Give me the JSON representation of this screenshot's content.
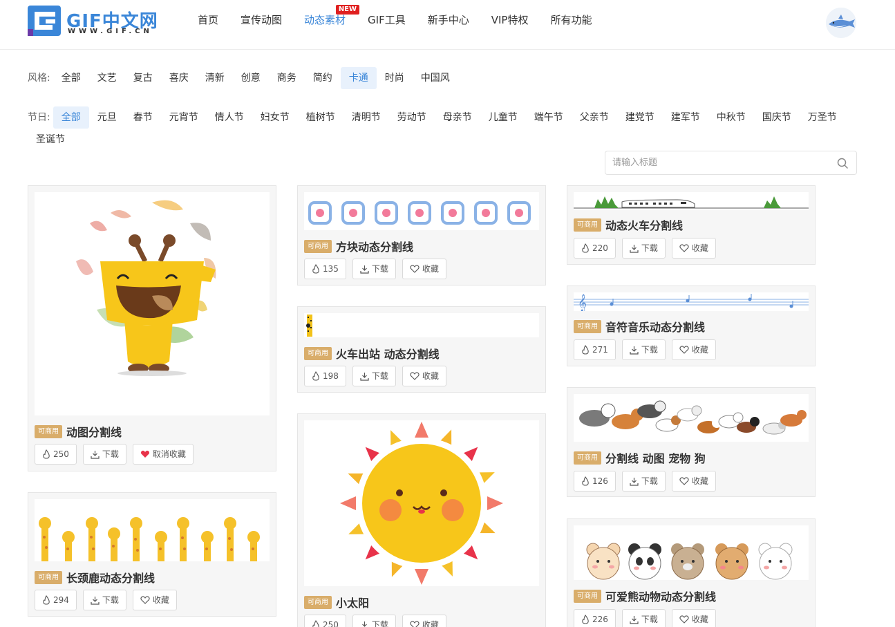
{
  "header": {
    "logo_text": "GIF中文网",
    "logo_sub": "WWW.GIF.CN",
    "nav": [
      {
        "label": "首页",
        "active": false
      },
      {
        "label": "宣传动图",
        "active": false
      },
      {
        "label": "动态素材",
        "active": true,
        "badge": "NEW"
      },
      {
        "label": "GIF工具",
        "active": false
      },
      {
        "label": "新手中心",
        "active": false
      },
      {
        "label": "VIP特权",
        "active": false
      },
      {
        "label": "所有功能",
        "active": false
      }
    ]
  },
  "filters": {
    "style": {
      "label": "风格:",
      "items": [
        "全部",
        "文艺",
        "复古",
        "喜庆",
        "清新",
        "创意",
        "商务",
        "简约",
        "卡通",
        "时尚",
        "中国风"
      ],
      "selected": "卡通"
    },
    "festival": {
      "label": "节日:",
      "items": [
        "全部",
        "元旦",
        "春节",
        "元宵节",
        "情人节",
        "妇女节",
        "植树节",
        "清明节",
        "劳动节",
        "母亲节",
        "儿童节",
        "端午节",
        "父亲节",
        "建党节",
        "建军节",
        "中秋节",
        "国庆节",
        "万圣节",
        "圣诞节"
      ],
      "selected": "全部"
    }
  },
  "search": {
    "placeholder": "请输入标题"
  },
  "labels": {
    "commercial": "可商用",
    "download": "下载",
    "favorite": "收藏",
    "unfavorite": "取消收藏"
  },
  "cards": {
    "c1": {
      "title": "动图分割线",
      "hot": "250",
      "favorited": true
    },
    "c2": {
      "title": "长颈鹿动态分割线",
      "hot": "294",
      "favorited": false
    },
    "c3": {
      "title": "方块动态分割线",
      "hot": "135",
      "favorited": false
    },
    "c4": {
      "title": "火车出站 动态分割线",
      "hot": "198",
      "favorited": false
    },
    "c5": {
      "title": "小太阳",
      "hot": "250",
      "favorited": false
    },
    "c6": {
      "title": "动态火车分割线",
      "hot": "220",
      "favorited": false
    },
    "c7": {
      "title": "音符音乐动态分割线",
      "hot": "271",
      "favorited": false
    },
    "c8": {
      "title": "分割线 动图 宠物 狗",
      "hot": "126",
      "favorited": false
    },
    "c9": {
      "title": "可爱熊动物动态分割线",
      "hot": "226",
      "favorited": false
    }
  },
  "colors": {
    "accent": "#3a86d8",
    "tag": "#d9ad6a",
    "heart": "#e8334a"
  }
}
